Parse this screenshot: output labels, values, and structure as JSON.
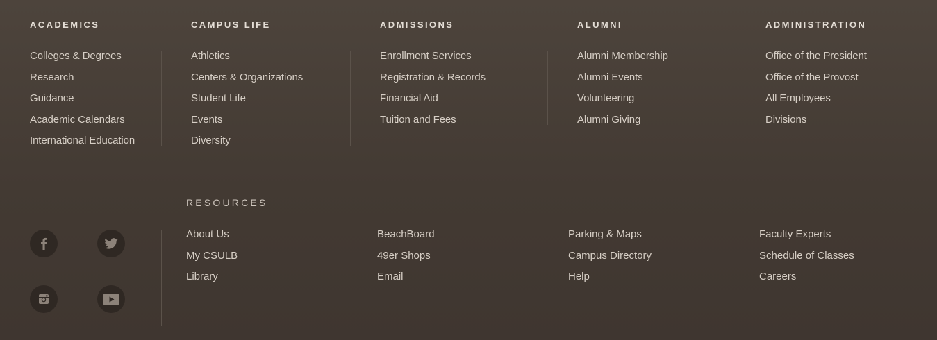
{
  "columns": [
    {
      "title": "ACADEMICS",
      "links": [
        "Colleges & Degrees",
        "Research",
        "Guidance",
        "Academic Calendars",
        "International Education"
      ]
    },
    {
      "title": "CAMPUS LIFE",
      "links": [
        "Athletics",
        "Centers & Organizations",
        "Student Life",
        "Events",
        "Diversity"
      ]
    },
    {
      "title": "ADMISSIONS",
      "links": [
        "Enrollment Services",
        "Registration & Records",
        "Financial Aid",
        "Tuition and Fees"
      ]
    },
    {
      "title": "ALUMNI",
      "links": [
        "Alumni Membership",
        "Alumni Events",
        "Volunteering",
        "Alumni Giving"
      ]
    },
    {
      "title": "ADMINISTRATION",
      "links": [
        "Office of the President",
        "Office of the Provost",
        "All Employees",
        "Divisions"
      ]
    }
  ],
  "resources": {
    "title": "RESOURCES",
    "columns": [
      [
        "About Us",
        "My CSULB",
        "Library"
      ],
      [
        "BeachBoard",
        "49er Shops",
        "Email"
      ],
      [
        "Parking & Maps",
        "Campus Directory",
        "Help"
      ],
      [
        "Faculty Experts",
        "Schedule of Classes",
        "Careers"
      ]
    ]
  },
  "social": {
    "icons": [
      "facebook-icon",
      "twitter-icon",
      "instagram-icon",
      "youtube-icon"
    ]
  },
  "colors": {
    "background": "#4a413a",
    "text": "#d6cec5",
    "heading": "#e4ddd5",
    "icon_circle": "#2f2823",
    "icon_glyph": "#8c8279",
    "divider": "#5b524a"
  }
}
